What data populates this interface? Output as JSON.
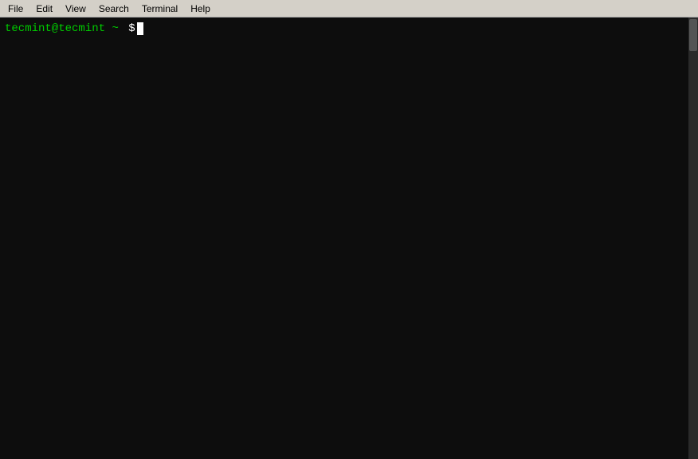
{
  "menubar": {
    "items": [
      {
        "id": "file",
        "label": "File"
      },
      {
        "id": "edit",
        "label": "Edit"
      },
      {
        "id": "view",
        "label": "View"
      },
      {
        "id": "search",
        "label": "Search"
      },
      {
        "id": "terminal",
        "label": "Terminal"
      },
      {
        "id": "help",
        "label": "Help"
      }
    ]
  },
  "terminal": {
    "prompt": {
      "user_host": "tecmint@tecmint",
      "path": "~",
      "symbol": "$"
    }
  },
  "colors": {
    "menubar_bg": "#d4d0c8",
    "terminal_bg": "#0d0d0d",
    "prompt_green": "#00cc00",
    "prompt_white": "#ffffff",
    "cursor_bg": "#ffffff"
  }
}
